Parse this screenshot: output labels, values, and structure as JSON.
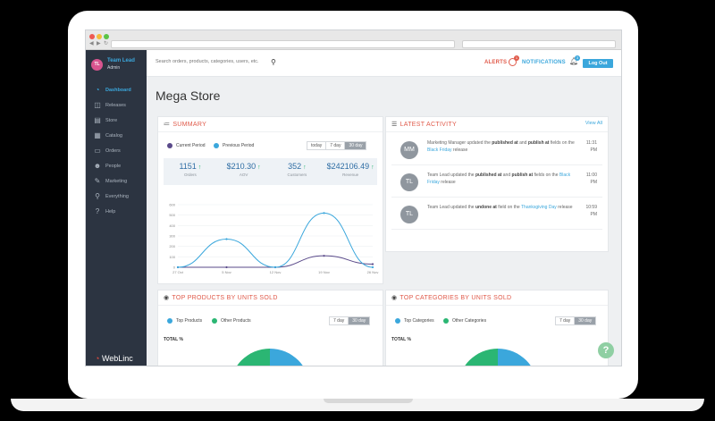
{
  "browser": {
    "url_text": ""
  },
  "user": {
    "initials": "TL",
    "name": "Team Lead",
    "role": "Admin"
  },
  "sidebar": {
    "items": [
      {
        "label": "Dashboard",
        "icon": "dashboard-icon",
        "active": true
      },
      {
        "label": "Releases",
        "icon": "releases-icon"
      },
      {
        "label": "Store",
        "icon": "store-icon"
      },
      {
        "label": "Catalog",
        "icon": "catalog-icon"
      },
      {
        "label": "Orders",
        "icon": "orders-icon"
      },
      {
        "label": "People",
        "icon": "people-icon"
      },
      {
        "label": "Marketing",
        "icon": "marketing-icon"
      },
      {
        "label": "Everything",
        "icon": "search-icon"
      },
      {
        "label": "Help",
        "icon": "help-icon"
      }
    ],
    "logo": "WebLinc"
  },
  "topbar": {
    "search_placeholder": "Search orders, products, categories, users, etc.",
    "alerts_label": "ALERTS",
    "alerts_count": "1",
    "notifications_label": "NOTIFICATIONS",
    "notifications_count": "3",
    "logout_label": "Log Out"
  },
  "page_title": "Mega Store",
  "summary": {
    "title": "SUMMARY",
    "legend_current": "Current Period",
    "legend_previous": "Previous Period",
    "ranges": [
      "today",
      "7 day",
      "30 day"
    ],
    "active_range": "30 day",
    "stats": [
      {
        "value": "1151",
        "label": "Orders"
      },
      {
        "value": "$210.30",
        "label": "AOV"
      },
      {
        "value": "352",
        "label": "Customers"
      },
      {
        "value": "$242106.49",
        "label": "Revenue"
      }
    ]
  },
  "chart_data": {
    "type": "line",
    "x": [
      "27 Oct",
      "5 Nov",
      "12 Nov",
      "19 Nov",
      "26 Nov"
    ],
    "yticks": [
      0,
      100,
      200,
      300,
      400,
      500,
      600
    ],
    "ylim": [
      0,
      600
    ],
    "series": [
      {
        "name": "Current Period",
        "color": "#5a4a8a",
        "values": [
          0,
          0,
          0,
          110,
          30
        ]
      },
      {
        "name": "Previous Period",
        "color": "#3ba7dc",
        "values": [
          0,
          270,
          0,
          520,
          0
        ]
      }
    ],
    "grid": true
  },
  "activity": {
    "title": "LATEST ACTIVITY",
    "view_all": "View All",
    "items": [
      {
        "initials": "MM",
        "actor": "Marketing Manager updated the",
        "b1": "published at",
        "mid": "and",
        "b2": "publish at",
        "tail": "fields on the",
        "link": "Black Friday",
        "end": "release",
        "time1": "11:31",
        "time2": "PM"
      },
      {
        "initials": "TL",
        "actor": "Team Lead updated the",
        "b1": "published at",
        "mid": "and",
        "b2": "publish at",
        "tail": "fields on the",
        "link": "Black Friday",
        "end": "release",
        "time1": "11:00",
        "time2": "PM"
      },
      {
        "initials": "TL",
        "actor": "Team Lead updated the",
        "b1": "undone at",
        "mid": "",
        "b2": "",
        "tail": "field on the",
        "link": "Thanksgiving Day",
        "end": "release",
        "time1": "10:59",
        "time2": "PM"
      }
    ]
  },
  "top_products": {
    "title": "TOP PRODUCTS BY UNITS SOLD",
    "legend_a": "Top Products",
    "legend_b": "Other Products",
    "ranges": [
      "7 day",
      "30 day"
    ],
    "total_label": "TOTAL %"
  },
  "top_categories": {
    "title": "TOP CATEGORIES BY UNITS SOLD",
    "legend_a": "Top Categories",
    "legend_b": "Other Categories",
    "ranges": [
      "7 day",
      "30 day"
    ],
    "total_label": "TOTAL %"
  },
  "colors": {
    "accent": "#3ba7dc",
    "alert": "#e05a4a",
    "sidebar": "#2c3441",
    "green": "#2bb673"
  }
}
